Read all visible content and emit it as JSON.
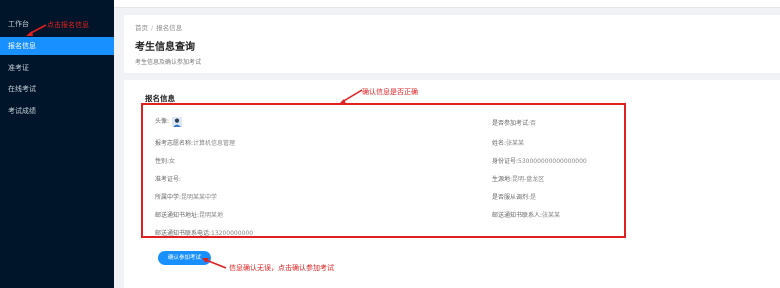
{
  "sidebar": {
    "items": [
      {
        "label": "工作台"
      },
      {
        "label": "报名信息"
      },
      {
        "label": "准考证"
      },
      {
        "label": "在线考试"
      },
      {
        "label": "考试成绩"
      }
    ]
  },
  "breadcrumb": {
    "home": "首页",
    "separator": "/",
    "current": "报名信息"
  },
  "page": {
    "title": "考生信息查询",
    "subtitle": "考生信息及确认参加考试"
  },
  "section": {
    "title": "报名信息"
  },
  "fields": {
    "avatar_label": "头像:",
    "major_label": "报考志愿名称:",
    "major_value": "计算机信息管理",
    "gender_label": "性别:",
    "gender_value": "女",
    "ticket_label": "准考证号:",
    "school_label": "所属中学:",
    "school_value": "昆明某某中学",
    "address_label": "邮送通知书地址:",
    "address_value": "昆明某地",
    "phone_label": "邮送通知书联系电话:",
    "phone_value": "13200000000",
    "confirmed_label": "是否参加考试:",
    "confirmed_value": "否",
    "name_label": "姓名:",
    "name_value": "张某某",
    "idcard_label": "身份证号:",
    "idcard_value": "530000000000000000",
    "origin_label": "生源地:",
    "origin_value": "昆明-盘龙区",
    "obey_label": "是否服从调剂:",
    "obey_value": "是",
    "contact_label": "邮送通知书联系人:",
    "contact_value": "张某某"
  },
  "confirm_button": {
    "label": "确认参加考试"
  },
  "annotations": {
    "sidebar_note": "点击报名信息",
    "check_note": "确认信息是否正确",
    "button_note": "信息确认无误，点击确认参加考试"
  },
  "colors": {
    "sidebar_bg": "#001529",
    "active": "#1890ff",
    "annotation": "#e02020"
  }
}
